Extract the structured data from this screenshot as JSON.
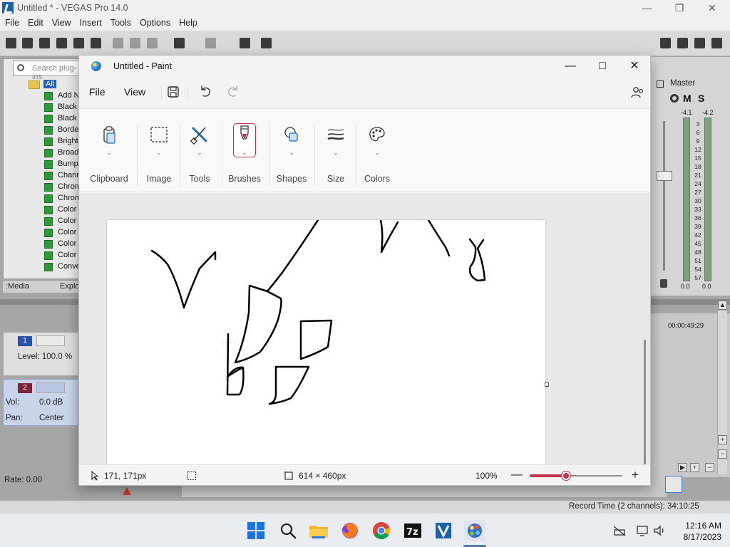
{
  "vegas": {
    "title": "Untitled * - VEGAS Pro 14.0",
    "menu": [
      "File",
      "Edit",
      "View",
      "Insert",
      "Tools",
      "Options",
      "Help"
    ],
    "search_placeholder": "Search plug-ins",
    "tree_root": "All",
    "plugins": [
      "Add N",
      "Black",
      "Black",
      "Borde",
      "Bright",
      "Broad",
      "Bump",
      "Chann",
      "Chrom",
      "Chrom",
      "Color",
      "Color",
      "Color",
      "Color",
      "Color",
      "Conve"
    ],
    "tabs": [
      ":Media",
      "Explo"
    ],
    "track1": {
      "number": "1",
      "level": "Level: 100.0 %"
    },
    "track2": {
      "number": "2",
      "vol_label": "Vol:",
      "vol_value": "0.0 dB",
      "pan_label": "Pan:",
      "pan_value": "Center"
    },
    "rate": "Rate: 0.00",
    "master": "Master",
    "master_m": "M",
    "master_s": "S",
    "peak_left": "-4.1",
    "peak_right": "-4.2",
    "meter_scale": [
      "3",
      "6",
      "9",
      "12",
      "15",
      "18",
      "21",
      "24",
      "27",
      "30",
      "33",
      "36",
      "39",
      "42",
      "45",
      "48",
      "51",
      "54",
      "57"
    ],
    "meter_bottom_left": "0.0",
    "meter_bottom_right": "0.0",
    "timeline_time": "00:00:49:29",
    "record_time": "Record Time (2 channels): 34:10:25"
  },
  "paint": {
    "title": "Untitled - Paint",
    "menu": {
      "file": "File",
      "view": "View"
    },
    "groups": {
      "clipboard": "Clipboard",
      "image": "Image",
      "tools": "Tools",
      "brushes": "Brushes",
      "shapes": "Shapes",
      "size": "Size",
      "colors": "Colors"
    },
    "status": {
      "cursor": "171, 171px",
      "canvas_size": "614 × 460px",
      "zoom": "100%"
    },
    "zoom_level": 0.4,
    "accent": "#c4314b"
  },
  "taskbar": {
    "time": "12:16 AM",
    "date": "8/17/2023",
    "apps": [
      "start-icon",
      "search-icon",
      "file-explorer-icon",
      "firefox-icon",
      "chrome-icon",
      "7zip-icon",
      "vegas-icon",
      "paint-icon"
    ]
  }
}
